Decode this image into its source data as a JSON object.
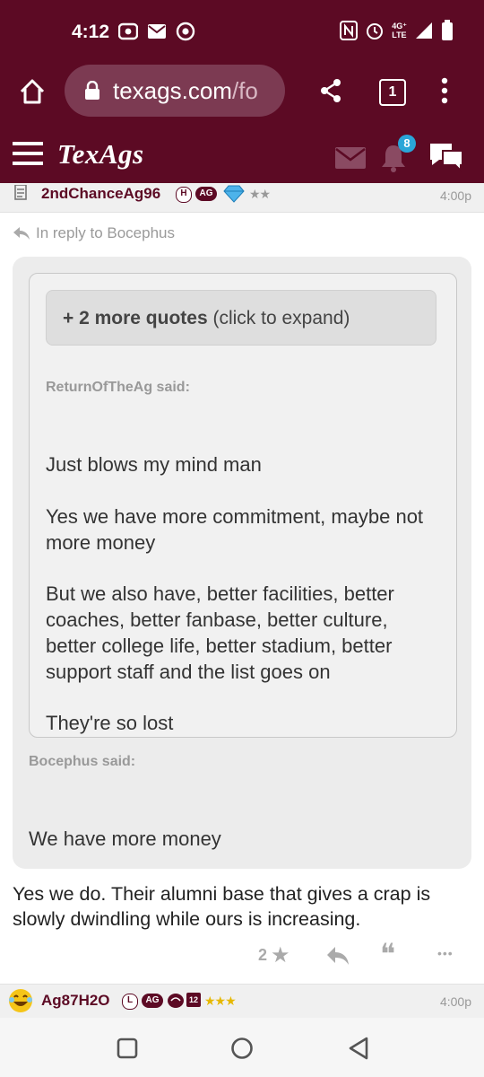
{
  "status_bar": {
    "time": "4:12",
    "network": "4G⁺",
    "network_sub": "LTE"
  },
  "browser": {
    "url_main": "texags.com",
    "url_dim": "/fo",
    "tab_count": "1"
  },
  "site": {
    "logo": "TexAgs",
    "notification_count": "8"
  },
  "post": {
    "username": "2ndChanceAg96",
    "badge_h": "H",
    "badge_ag": "AG",
    "stars": "★★",
    "time": "4:00p",
    "reply_to": "In reply to Bocephus",
    "expand_bold": "+ 2 more quotes",
    "expand_rest": " (click to expand)",
    "quote1_author": "ReturnOfTheAg said:",
    "quote1_p1": "Just blows my mind man",
    "quote1_p2": "Yes we have more commitment, maybe not more money",
    "quote1_p3": "But we also have, better facilities, better coaches, better fanbase, better culture, better college life, better stadium, better support staff and the list goes on",
    "quote1_p4": "They're so lost",
    "quote2_author": "Bocephus said:",
    "quote2_p1": "We have more money",
    "body": "Yes we do. Their alumni base that gives a crap is slowly dwindling while ours is increasing.",
    "star_count": "2",
    "star_glyph": "★",
    "quote_glyph": "❝",
    "more_glyph": "•••"
  },
  "next_post": {
    "username": "Ag87H2O",
    "badge_l": "L",
    "badge_ag": "AG",
    "badge_12": "12",
    "stars": "★★★",
    "time": "4:00p"
  },
  "colors": {
    "brand": "#5c0a24",
    "accent": "#2aa6d8"
  }
}
